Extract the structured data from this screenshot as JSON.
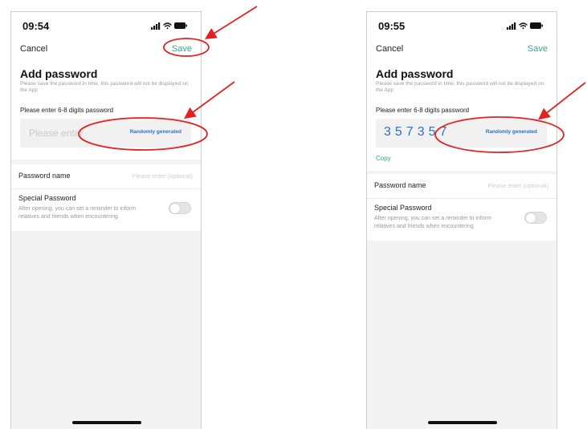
{
  "screens": [
    {
      "status": {
        "time": "09:54"
      },
      "nav": {
        "cancel": "Cancel",
        "save": "Save"
      },
      "form": {
        "title": "Add password",
        "subtitle": "Please save the password in time, this password will not be displayed on the App",
        "enter_label": "Please enter 6-8 digits password",
        "placeholder": "Please enter",
        "random_button": "Randomly generated"
      },
      "password_name": {
        "label": "Password name",
        "placeholder": "Please enter (optional)"
      },
      "special": {
        "title": "Special Password",
        "description": "After opening, you can set a reminder to inform relatives and friends when encountering",
        "toggle_on": false
      }
    },
    {
      "status": {
        "time": "09:55"
      },
      "nav": {
        "cancel": "Cancel",
        "save": "Save"
      },
      "form": {
        "title": "Add password",
        "subtitle": "Please save the password in time, this password will not be displayed on the App",
        "enter_label": "Please enter 6-8 digits password",
        "password_value": "357357",
        "random_button": "Randomly generated",
        "copy": "Copy"
      },
      "password_name": {
        "label": "Password name",
        "placeholder": "Please enter (optional)"
      },
      "special": {
        "title": "Special Password",
        "description": "After opening, you can set a reminder to inform relatives and friends when encountering",
        "toggle_on": false
      }
    }
  ],
  "colors": {
    "accent_green": "#37a58f",
    "link_blue": "#2d72c4",
    "annotation_red": "#e02222",
    "screen_bg": "#f3f3f3"
  },
  "icons": [
    "cellular-signal-icon",
    "wifi-icon",
    "battery-icon",
    "red-arrow-annotation",
    "red-circle-annotation"
  ]
}
